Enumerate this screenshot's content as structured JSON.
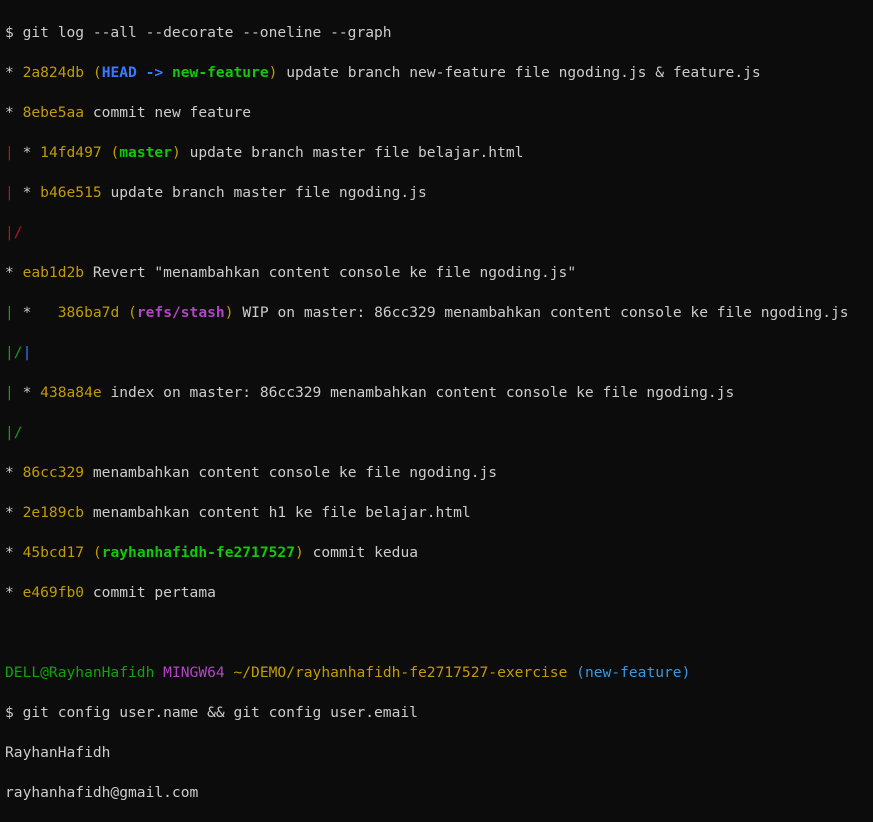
{
  "terminal": {
    "cmd1": "$ git log --all --decorate --oneline --graph",
    "log": [
      {
        "hash": "2a824db",
        "msg": "update branch new-feature file ngoding.js & feature.js"
      },
      {
        "hash": "8ebe5aa",
        "msg": "commit new feature"
      },
      {
        "hash": "14fd497",
        "msg": "update branch master file belajar.html"
      },
      {
        "hash": "b46e515",
        "msg": "update branch master file ngoding.js"
      },
      {
        "hash": "eab1d2b",
        "msg": "Revert \"menambahkan content console ke file ngoding.js\""
      },
      {
        "hash": "386ba7d",
        "msg": "WIP on master: 86cc329 menambahkan content console ke file ngoding.js"
      },
      {
        "hash": "438a84e",
        "msg": "index on master: 86cc329 menambahkan content console ke file ngoding.js"
      },
      {
        "hash": "86cc329",
        "msg": "menambahkan content console ke file ngoding.js"
      },
      {
        "hash": "2e189cb",
        "msg": "menambahkan content h1 ke file belajar.html"
      },
      {
        "hash": "45bcd17",
        "msg": "commit kedua"
      },
      {
        "hash": "e469fb0",
        "msg": "commit pertama"
      }
    ],
    "refs": {
      "head": "HEAD -> ",
      "new_feature": "new-feature",
      "master": "master",
      "stash": "refs/stash",
      "rayhan": "rayhanhafidh-fe2717527"
    },
    "prompt": {
      "user": "DELL@RayhanHafidh",
      "system": "MINGW64",
      "path": "~/DEMO/rayhanhafidh-fe2717527-exercise",
      "branch": "(new-feature)"
    },
    "cmd2": "$ git config user.name && git config user.email",
    "out1": "RayhanHafidh",
    "out2": "rayhanhafidh@gmail.com"
  },
  "colors": {
    "background": "#0c0c0c",
    "text": "#cccccc",
    "hash": "#c19c00",
    "head": "#3b78ff",
    "branch": "#16c60c",
    "stash": "#b146c2",
    "graph_red": "#c50f1f",
    "graph_green": "#13a10e",
    "graph_blue": "#3b78ff",
    "prompt_branch": "#3a96dd"
  }
}
